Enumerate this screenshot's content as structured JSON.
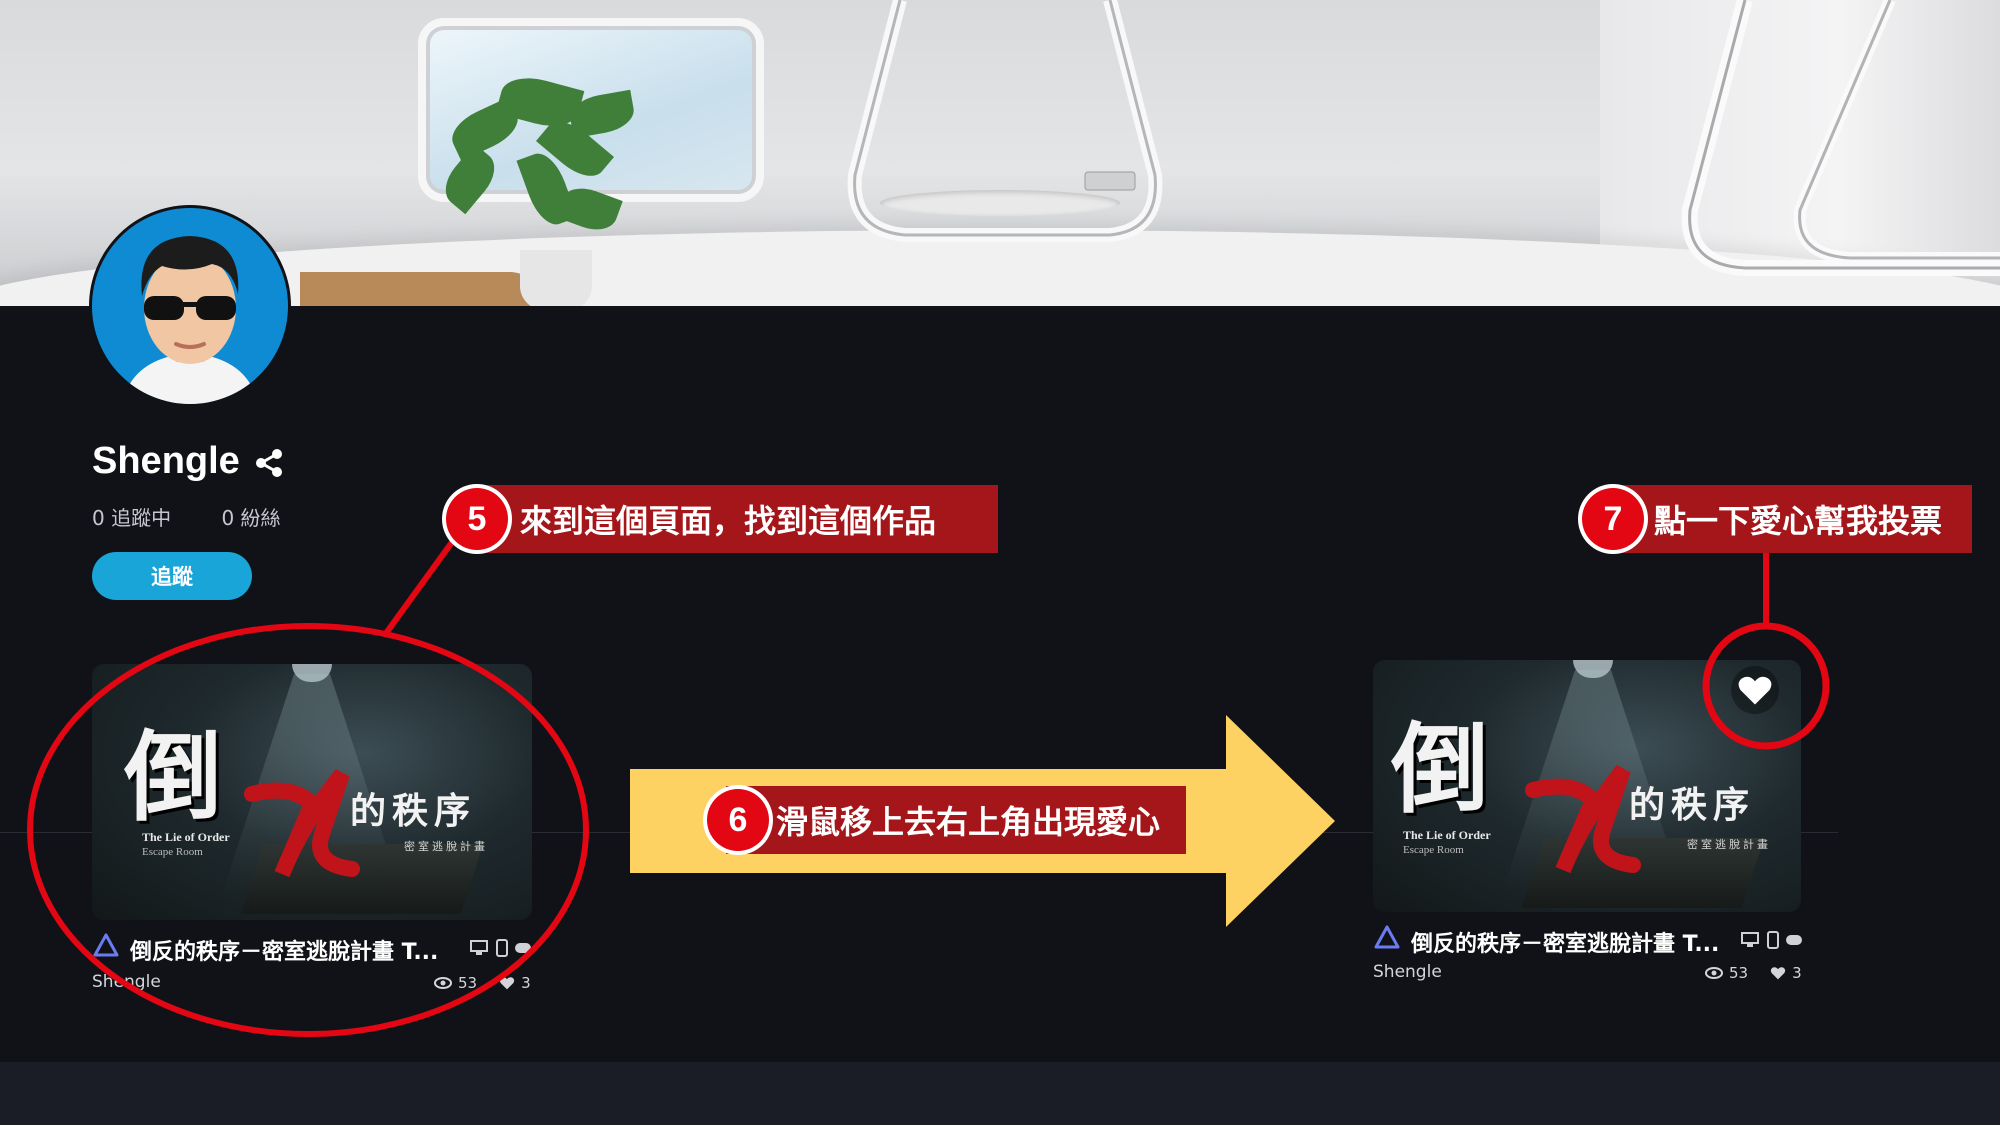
{
  "profile": {
    "username": "Shengle",
    "following": "0 追蹤中",
    "followers": "0 紛絲",
    "follow_button": "追蹤"
  },
  "cards": [
    {
      "thumb_big": "倒",
      "thumb_sub": "的秩序",
      "thumb_en_title": "The Lie of Order",
      "thumb_en_sub": "Escape Room",
      "thumb_small_cn": "密室逃脫計畫",
      "title": "倒反的秩序－密室逃脫計畫 T...",
      "author": "Shengle",
      "views": "53",
      "likes": "3"
    },
    {
      "thumb_big": "倒",
      "thumb_sub": "的秩序",
      "thumb_en_title": "The Lie of Order",
      "thumb_en_sub": "Escape Room",
      "thumb_small_cn": "密室逃脫計畫",
      "title": "倒反的秩序－密室逃脫計畫 T...",
      "author": "Shengle",
      "views": "53",
      "likes": "3"
    }
  ],
  "annotations": {
    "step5": {
      "number": "5",
      "text": "來到這個頁面，找到這個作品"
    },
    "step6": {
      "number": "6",
      "text": "滑鼠移上去右上角出現愛心"
    },
    "step7": {
      "number": "7",
      "text": "點一下愛心幫我投票"
    }
  },
  "colors": {
    "background": "#111217",
    "follow_button": "#19a5d8",
    "label_red": "#a4161a",
    "badge_red": "#e30613",
    "arrow_yellow": "#fdd262",
    "circle_red": "#e30613"
  },
  "icons": [
    "share-icon",
    "platform-logo-icon",
    "desktop-icon",
    "mobile-icon",
    "vr-headset-icon",
    "eye-icon",
    "heart-icon"
  ]
}
